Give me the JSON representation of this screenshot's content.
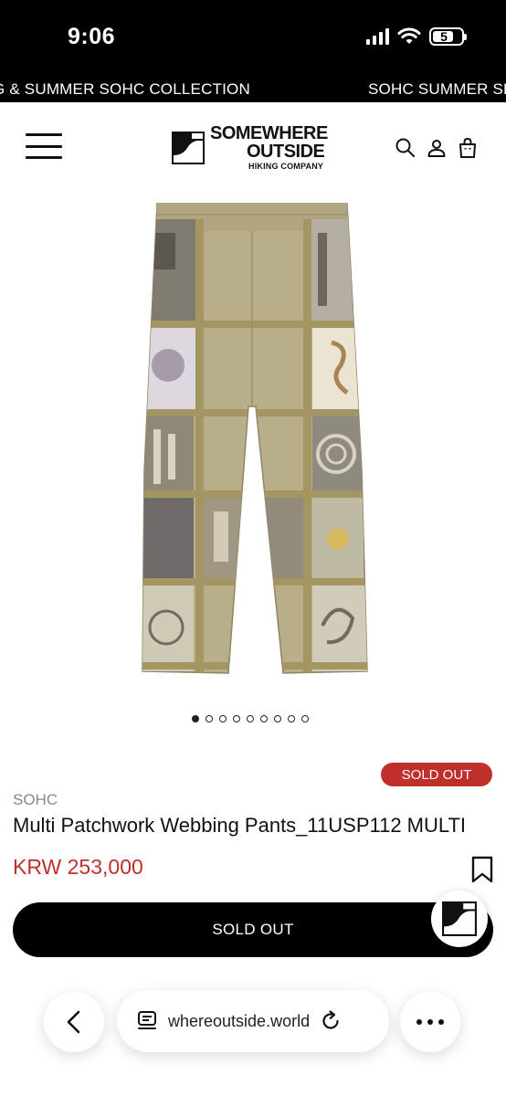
{
  "status_bar": {
    "time": "9:06",
    "battery": "5"
  },
  "marquee": {
    "items": [
      "G & SUMMER SOHC COLLECTION",
      "SOHC SUMMER SEA"
    ]
  },
  "header": {
    "logo_line1": "SOMEWHERE",
    "logo_line2": "OUTSIDE",
    "logo_line3": "HIKING COMPANY"
  },
  "carousel": {
    "total": 9,
    "active_index": 0
  },
  "product": {
    "badge": "SOLD OUT",
    "brand": "SOHC",
    "title": "Multi Patchwork Webbing Pants_11USP112 MULTI",
    "price": "KRW 253,000",
    "button_label": "SOLD OUT"
  },
  "browser": {
    "url": "whereoutside.world"
  },
  "colors": {
    "accent_red": "#c0302a",
    "black": "#000000",
    "khaki": "#b5ab86"
  }
}
